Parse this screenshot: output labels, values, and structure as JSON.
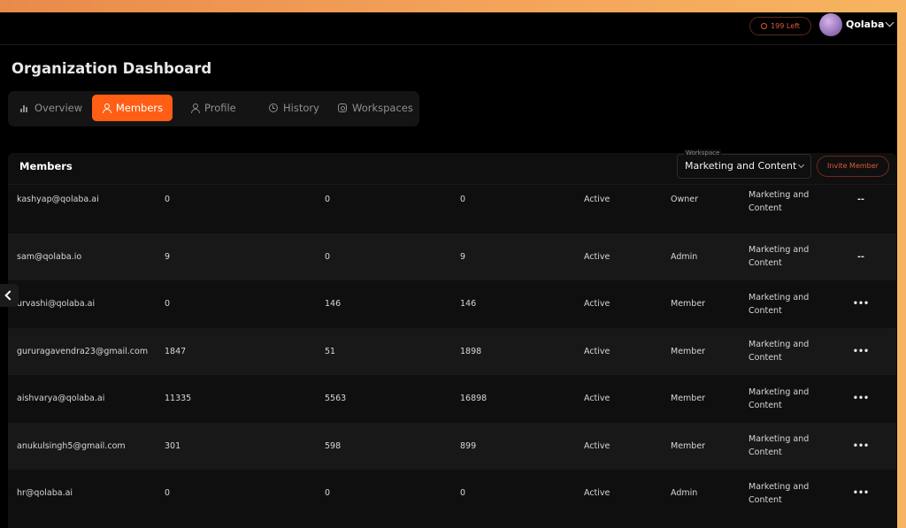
{
  "header": {
    "credits_label": "199 Left",
    "username": "Qolaba"
  },
  "page": {
    "title": "Organization Dashboard"
  },
  "tabs": [
    {
      "label": "Overview",
      "icon": "bar-chart-icon",
      "active": false
    },
    {
      "label": "Members",
      "icon": "person-icon",
      "active": true
    },
    {
      "label": "Profile",
      "icon": "person-icon",
      "active": false
    },
    {
      "label": "History",
      "icon": "history-icon",
      "active": false
    },
    {
      "label": "Workspaces",
      "icon": "group-icon",
      "active": false
    }
  ],
  "members_panel": {
    "title": "Members",
    "workspace_label": "Workspace",
    "workspace_value": "Marketing and Content",
    "invite_label": "Invite Member"
  },
  "members": [
    {
      "email": "kashyap@qolaba.ai",
      "a": "0",
      "b": "0",
      "c": "0",
      "status": "Active",
      "role": "Owner",
      "workspace": "Marketing and Content",
      "action": "--"
    },
    {
      "email": "sam@qolaba.io",
      "a": "9",
      "b": "0",
      "c": "9",
      "status": "Active",
      "role": "Admin",
      "workspace": "Marketing and Content",
      "action": "--"
    },
    {
      "email": "urvashi@qolaba.ai",
      "a": "0",
      "b": "146",
      "c": "146",
      "status": "Active",
      "role": "Member",
      "workspace": "Marketing and Content",
      "action": "•••"
    },
    {
      "email": "gururagavendra23@gmail.com",
      "a": "1847",
      "b": "51",
      "c": "1898",
      "status": "Active",
      "role": "Member",
      "workspace": "Marketing and Content",
      "action": "•••"
    },
    {
      "email": "aishvarya@qolaba.ai",
      "a": "11335",
      "b": "5563",
      "c": "16898",
      "status": "Active",
      "role": "Member",
      "workspace": "Marketing and Content",
      "action": "•••"
    },
    {
      "email": "anukulsingh5@gmail.com",
      "a": "301",
      "b": "598",
      "c": "899",
      "status": "Active",
      "role": "Member",
      "workspace": "Marketing and Content",
      "action": "•••"
    },
    {
      "email": "hr@qolaba.ai",
      "a": "0",
      "b": "0",
      "c": "0",
      "status": "Active",
      "role": "Admin",
      "workspace": "Marketing and Content",
      "action": "•••"
    }
  ],
  "colors": {
    "accent": "#ff5e14",
    "background": "#000000",
    "panel": "#0f0f0f",
    "outer_gradient": "#f4a35a"
  }
}
